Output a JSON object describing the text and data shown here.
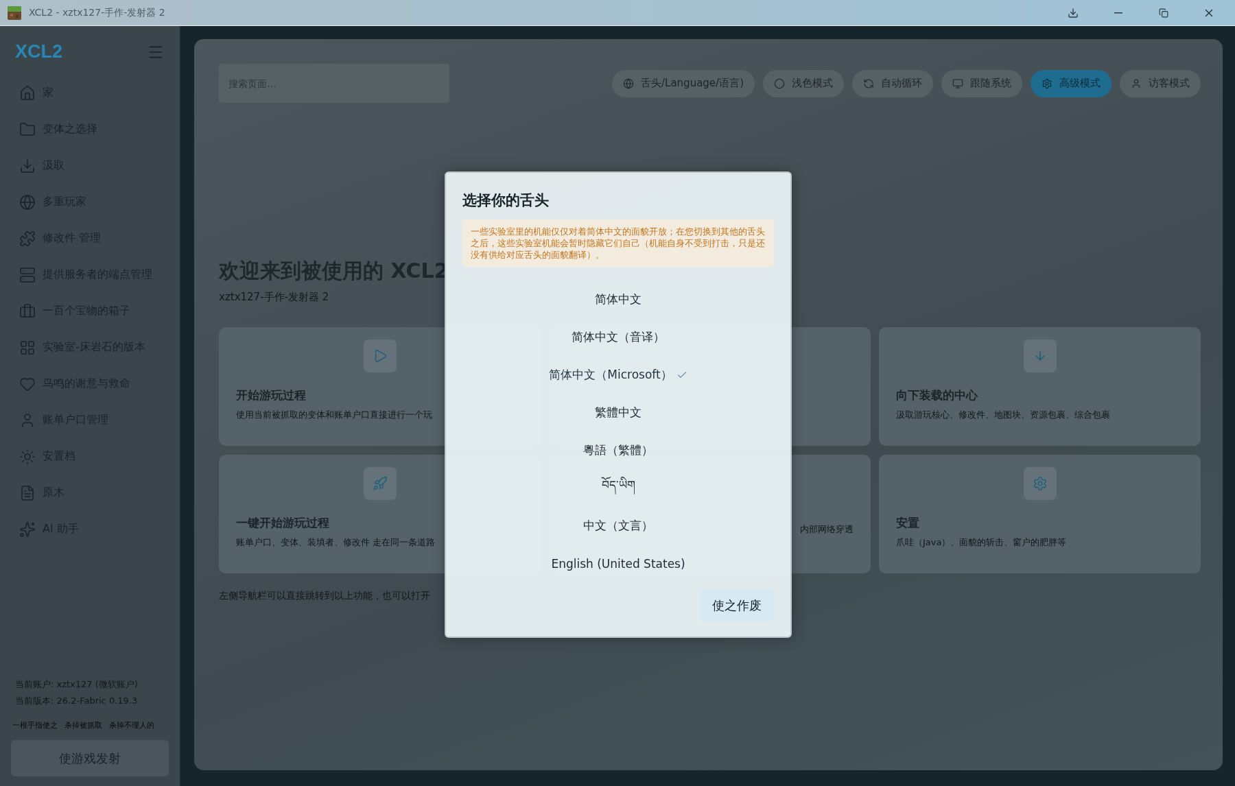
{
  "window": {
    "title": "XCL2 - xztx127-手作-发射器 2"
  },
  "sidebar": {
    "logo": "XCL2",
    "items": [
      {
        "label": "家"
      },
      {
        "label": "变体之选择"
      },
      {
        "label": "汲取"
      },
      {
        "label": "多重玩家"
      },
      {
        "label": "修改件 管理"
      },
      {
        "label": "提供服务者的端点管理"
      },
      {
        "label": "一百个宝物的箱子"
      },
      {
        "label": "实验室-床岩石的版本"
      },
      {
        "label": "鸟鸣的谢意与救命"
      },
      {
        "label": "账单户口管理"
      },
      {
        "label": "安置档"
      },
      {
        "label": "原木"
      },
      {
        "label": "AI 助手"
      }
    ],
    "account": "当前账户: xztx127 (微软账户)",
    "version": "当前版本: 26.2-Fabric 0.19.3",
    "quick_actions": [
      "一根手指使之",
      "杀掉被抓取",
      "杀掉不理人的"
    ],
    "launch_button": "使游戏发射"
  },
  "search": {
    "placeholder": "搜索页面..."
  },
  "toolbar": [
    {
      "label": "舌头/Language/语言)",
      "selected": false
    },
    {
      "label": "浅色模式",
      "selected": false
    },
    {
      "label": "自动循环",
      "selected": false
    },
    {
      "label": "跟随系统",
      "selected": false
    },
    {
      "label": "高级模式",
      "selected": true
    },
    {
      "label": "访客模式",
      "selected": false
    }
  ],
  "welcome": {
    "title": "欢迎来到被使用的 XCL2",
    "subtitle": "xztx127-手作-发射器 2"
  },
  "cards": [
    {
      "kind": "feature",
      "title": "开始游玩过程",
      "description": "使用当前被抓取的变体和账单户口直接进行一个玩"
    },
    {
      "kind": "covered"
    },
    {
      "kind": "feature",
      "title": "向下装载的中心",
      "description": "汲取游玩核心、修改件、地图块、资源包裹、综合包裹"
    },
    {
      "kind": "feature",
      "title": "一键开始游玩过程",
      "description": "账单户口、变体、装填者、修改件 走在同一条道路"
    },
    {
      "kind": "covered",
      "fragment": "内部网络穿透"
    },
    {
      "kind": "feature",
      "title": "安置",
      "description": "爪哇（Java）、面貌的斩击、窗户的肥胖等"
    }
  ],
  "hint": "左侧导航栏可以直接跳转到以上功能，也可以打开",
  "dialog": {
    "title": "选择你的舌头",
    "notice": "一些实验室里的机能仅仅对着简体中文的面貌开放；在您切换到其他的舌头之后，这些实验室机能会暂时隐藏它们自己（机能自身不受到打击，只是还没有供给对应舌头的面貌翻译）。",
    "options": [
      {
        "label": "简体中文",
        "selected": false
      },
      {
        "label": "简体中文（音译）",
        "selected": false
      },
      {
        "label": "简体中文（Microsoft）",
        "selected": true
      },
      {
        "label": "繁體中文",
        "selected": false
      },
      {
        "label": "粵語（繁體）",
        "selected": false
      },
      {
        "label": "བོད་ཡིག",
        "selected": false
      },
      {
        "label": "中文（文言）",
        "selected": false
      },
      {
        "label": "English (United States)",
        "selected": false
      }
    ],
    "cancel_button": "使之作废"
  }
}
